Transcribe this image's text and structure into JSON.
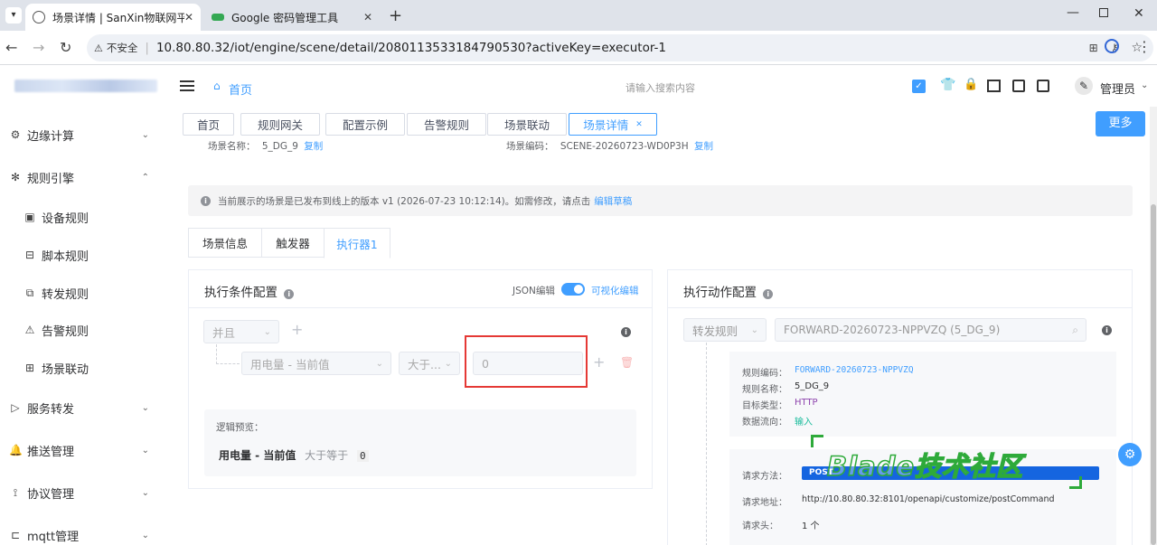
{
  "browser": {
    "tabs": [
      {
        "title": "场景详情 | SanXin物联网平台"
      },
      {
        "title": "Google 密码管理工具"
      }
    ],
    "security_label": "不安全",
    "url": "10.80.80.32/iot/engine/scene/detail/2080113533184790530?activeKey=executor-1"
  },
  "header": {
    "home_label": "首页",
    "search_placeholder": "请输入搜索内容",
    "user_label": "管理员"
  },
  "sidebar": {
    "items": [
      {
        "label": "边缘计算",
        "icon": "edge-icon"
      },
      {
        "label": "规则引擎",
        "icon": "rules-icon"
      },
      {
        "label": "设备规则",
        "icon": "device-rule-icon"
      },
      {
        "label": "脚本规则",
        "icon": "script-icon"
      },
      {
        "label": "转发规则",
        "icon": "forward-icon"
      },
      {
        "label": "告警规则",
        "icon": "alarm-icon"
      },
      {
        "label": "场景联动",
        "icon": "scene-icon"
      },
      {
        "label": "服务转发",
        "icon": "service-icon"
      },
      {
        "label": "推送管理",
        "icon": "bell-icon"
      },
      {
        "label": "协议管理",
        "icon": "protocol-icon"
      },
      {
        "label": "mqtt管理",
        "icon": "mqtt-icon"
      }
    ]
  },
  "tags": [
    {
      "label": "首页"
    },
    {
      "label": "规则网关"
    },
    {
      "label": "配置示例"
    },
    {
      "label": "告警规则"
    },
    {
      "label": "场景联动"
    },
    {
      "label": "场景详情"
    }
  ],
  "more_button": "更多",
  "scene": {
    "name_label": "场景名称：",
    "name_value": "5_DG_9",
    "code_label": "场景编码：",
    "code_value": "SCENE-20260723-WD0P3H",
    "copy_label": "复制"
  },
  "notice": {
    "text": "当前展示的场景是已发布到线上的版本 v1 (2026-07-23 10:12:14)。如需修改，请点击",
    "link": "编辑草稿"
  },
  "subtabs": [
    {
      "label": "场景信息"
    },
    {
      "label": "触发器"
    },
    {
      "label": "执行器1"
    }
  ],
  "condition": {
    "title": "执行条件配置",
    "json_label": "JSON编辑",
    "visual_label": "可视化编辑",
    "logic": "并且",
    "field": "用电量 - 当前值",
    "operator": "大于...",
    "value": "0",
    "preview_label": "逻辑预览：",
    "preview_field": "用电量 - 当前值",
    "preview_op": "大于等于",
    "preview_value": "0"
  },
  "action": {
    "title": "执行动作配置",
    "type": "转发规则",
    "rule_select": "FORWARD-20260723-NPPVZQ (5_DG_9)",
    "details": [
      {
        "key": "规则编码：",
        "value": "FORWARD-20260723-NPPVZQ"
      },
      {
        "key": "规则名称：",
        "value": "5_DG_9"
      },
      {
        "key": "目标类型：",
        "value": "HTTP"
      },
      {
        "key": "数据流向：",
        "value": "输入"
      }
    ],
    "method_label": "请求方法：",
    "method_value": "POST",
    "url_label": "请求地址：",
    "url_value": "http://10.80.80.32:8101/openapi/customize/postCommand",
    "headers_label": "请求头：",
    "headers_value": "1 个"
  },
  "watermark": "Blade技术社区",
  "colors": {
    "primary": "#409eff",
    "danger": "#f56c6c",
    "highlight_box": "#e53935",
    "watermark": "#2eaa3a"
  }
}
